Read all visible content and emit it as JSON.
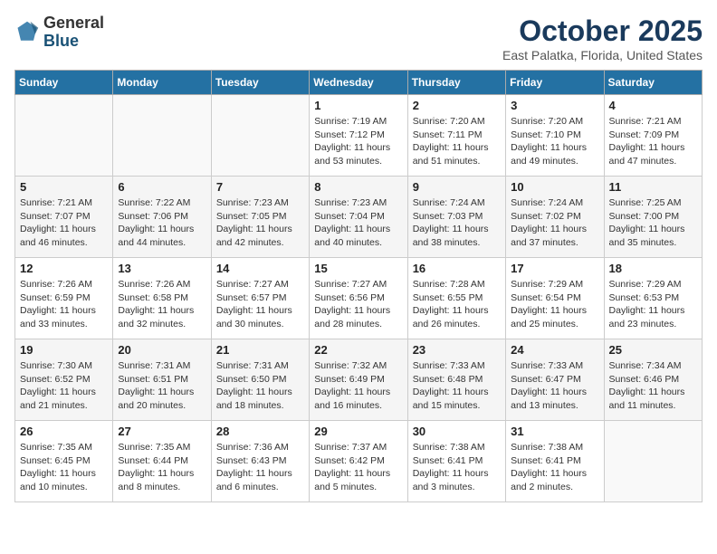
{
  "header": {
    "logo_general": "General",
    "logo_blue": "Blue",
    "month": "October 2025",
    "location": "East Palatka, Florida, United States"
  },
  "days_of_week": [
    "Sunday",
    "Monday",
    "Tuesday",
    "Wednesday",
    "Thursday",
    "Friday",
    "Saturday"
  ],
  "weeks": [
    [
      {
        "day": "",
        "detail": ""
      },
      {
        "day": "",
        "detail": ""
      },
      {
        "day": "",
        "detail": ""
      },
      {
        "day": "1",
        "detail": "Sunrise: 7:19 AM\nSunset: 7:12 PM\nDaylight: 11 hours and 53 minutes."
      },
      {
        "day": "2",
        "detail": "Sunrise: 7:20 AM\nSunset: 7:11 PM\nDaylight: 11 hours and 51 minutes."
      },
      {
        "day": "3",
        "detail": "Sunrise: 7:20 AM\nSunset: 7:10 PM\nDaylight: 11 hours and 49 minutes."
      },
      {
        "day": "4",
        "detail": "Sunrise: 7:21 AM\nSunset: 7:09 PM\nDaylight: 11 hours and 47 minutes."
      }
    ],
    [
      {
        "day": "5",
        "detail": "Sunrise: 7:21 AM\nSunset: 7:07 PM\nDaylight: 11 hours and 46 minutes."
      },
      {
        "day": "6",
        "detail": "Sunrise: 7:22 AM\nSunset: 7:06 PM\nDaylight: 11 hours and 44 minutes."
      },
      {
        "day": "7",
        "detail": "Sunrise: 7:23 AM\nSunset: 7:05 PM\nDaylight: 11 hours and 42 minutes."
      },
      {
        "day": "8",
        "detail": "Sunrise: 7:23 AM\nSunset: 7:04 PM\nDaylight: 11 hours and 40 minutes."
      },
      {
        "day": "9",
        "detail": "Sunrise: 7:24 AM\nSunset: 7:03 PM\nDaylight: 11 hours and 38 minutes."
      },
      {
        "day": "10",
        "detail": "Sunrise: 7:24 AM\nSunset: 7:02 PM\nDaylight: 11 hours and 37 minutes."
      },
      {
        "day": "11",
        "detail": "Sunrise: 7:25 AM\nSunset: 7:00 PM\nDaylight: 11 hours and 35 minutes."
      }
    ],
    [
      {
        "day": "12",
        "detail": "Sunrise: 7:26 AM\nSunset: 6:59 PM\nDaylight: 11 hours and 33 minutes."
      },
      {
        "day": "13",
        "detail": "Sunrise: 7:26 AM\nSunset: 6:58 PM\nDaylight: 11 hours and 32 minutes."
      },
      {
        "day": "14",
        "detail": "Sunrise: 7:27 AM\nSunset: 6:57 PM\nDaylight: 11 hours and 30 minutes."
      },
      {
        "day": "15",
        "detail": "Sunrise: 7:27 AM\nSunset: 6:56 PM\nDaylight: 11 hours and 28 minutes."
      },
      {
        "day": "16",
        "detail": "Sunrise: 7:28 AM\nSunset: 6:55 PM\nDaylight: 11 hours and 26 minutes."
      },
      {
        "day": "17",
        "detail": "Sunrise: 7:29 AM\nSunset: 6:54 PM\nDaylight: 11 hours and 25 minutes."
      },
      {
        "day": "18",
        "detail": "Sunrise: 7:29 AM\nSunset: 6:53 PM\nDaylight: 11 hours and 23 minutes."
      }
    ],
    [
      {
        "day": "19",
        "detail": "Sunrise: 7:30 AM\nSunset: 6:52 PM\nDaylight: 11 hours and 21 minutes."
      },
      {
        "day": "20",
        "detail": "Sunrise: 7:31 AM\nSunset: 6:51 PM\nDaylight: 11 hours and 20 minutes."
      },
      {
        "day": "21",
        "detail": "Sunrise: 7:31 AM\nSunset: 6:50 PM\nDaylight: 11 hours and 18 minutes."
      },
      {
        "day": "22",
        "detail": "Sunrise: 7:32 AM\nSunset: 6:49 PM\nDaylight: 11 hours and 16 minutes."
      },
      {
        "day": "23",
        "detail": "Sunrise: 7:33 AM\nSunset: 6:48 PM\nDaylight: 11 hours and 15 minutes."
      },
      {
        "day": "24",
        "detail": "Sunrise: 7:33 AM\nSunset: 6:47 PM\nDaylight: 11 hours and 13 minutes."
      },
      {
        "day": "25",
        "detail": "Sunrise: 7:34 AM\nSunset: 6:46 PM\nDaylight: 11 hours and 11 minutes."
      }
    ],
    [
      {
        "day": "26",
        "detail": "Sunrise: 7:35 AM\nSunset: 6:45 PM\nDaylight: 11 hours and 10 minutes."
      },
      {
        "day": "27",
        "detail": "Sunrise: 7:35 AM\nSunset: 6:44 PM\nDaylight: 11 hours and 8 minutes."
      },
      {
        "day": "28",
        "detail": "Sunrise: 7:36 AM\nSunset: 6:43 PM\nDaylight: 11 hours and 6 minutes."
      },
      {
        "day": "29",
        "detail": "Sunrise: 7:37 AM\nSunset: 6:42 PM\nDaylight: 11 hours and 5 minutes."
      },
      {
        "day": "30",
        "detail": "Sunrise: 7:38 AM\nSunset: 6:41 PM\nDaylight: 11 hours and 3 minutes."
      },
      {
        "day": "31",
        "detail": "Sunrise: 7:38 AM\nSunset: 6:41 PM\nDaylight: 11 hours and 2 minutes."
      },
      {
        "day": "",
        "detail": ""
      }
    ]
  ]
}
